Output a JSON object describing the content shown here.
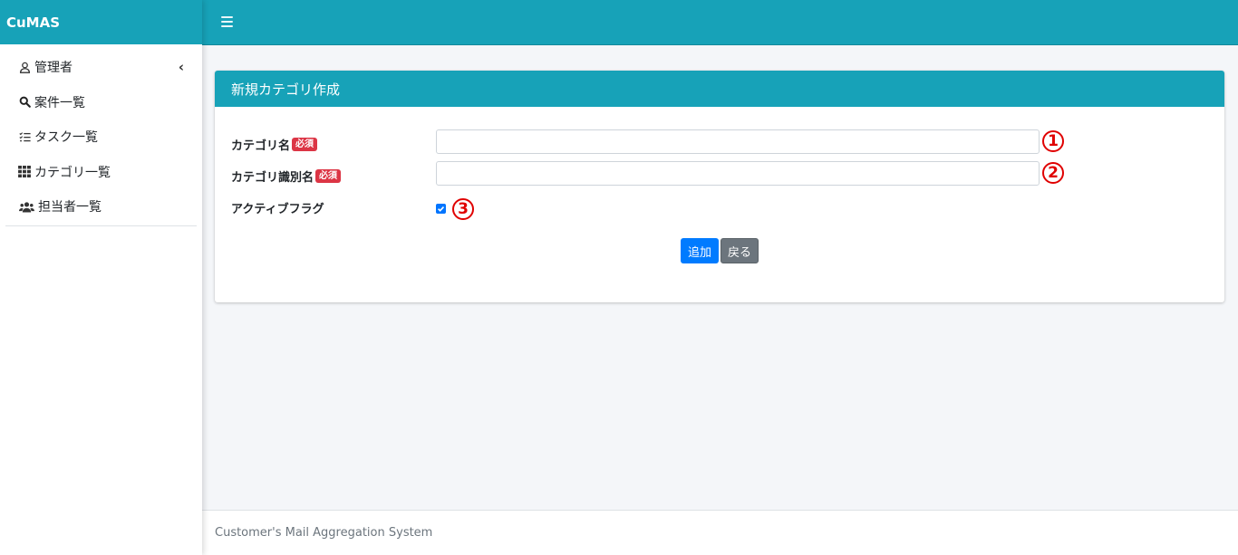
{
  "brand": {
    "name": "CuMAS"
  },
  "sidebar": {
    "items": [
      {
        "icon": "user-icon",
        "label": "管理者",
        "has_chevron": true
      },
      {
        "icon": "search-icon",
        "label": "案件一覧"
      },
      {
        "icon": "tasks-icon",
        "label": "タスク一覧"
      },
      {
        "icon": "grid-icon",
        "label": "カテゴリ一覧"
      },
      {
        "icon": "users-icon",
        "label": "担当者一覧"
      }
    ]
  },
  "header": {
    "menu_icon": "hamburger-icon"
  },
  "card": {
    "title": "新規カテゴリ作成",
    "fields": [
      {
        "label": "カテゴリ名",
        "required_badge": "必須",
        "value": "",
        "marker": "1"
      },
      {
        "label": "カテゴリ識別名",
        "required_badge": "必須",
        "value": "",
        "marker": "2"
      },
      {
        "label": "アクティブフラグ",
        "checked": true,
        "marker": "3"
      }
    ],
    "buttons": {
      "add": "追加",
      "back": "戻る"
    }
  },
  "footer": {
    "text": "Customer's Mail Aggregation System"
  },
  "colors": {
    "accent": "#17a2b8",
    "primary": "#007bff",
    "secondary": "#6c757d",
    "danger": "#dc3545",
    "marker": "#e00000"
  }
}
